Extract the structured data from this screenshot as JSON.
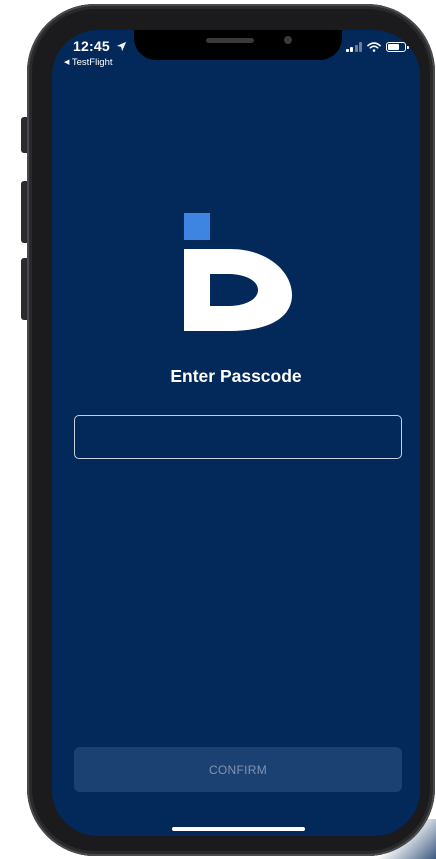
{
  "status_bar": {
    "time": "12:45",
    "back_app": "TestFlight",
    "icons": [
      "location-arrow-icon",
      "cellular-signal-icon",
      "wifi-icon",
      "battery-icon"
    ]
  },
  "logo": {
    "name": "id-logo",
    "colors": {
      "accent": "#3d85e0",
      "glyph": "#ffffff"
    }
  },
  "main": {
    "title": "Enter Passcode",
    "passcode_input": {
      "value": "",
      "placeholder": ""
    },
    "confirm_label": "CONFIRM"
  },
  "colors": {
    "background": "#03295a",
    "button_background": "#1b4173",
    "button_text": "#7f93b0",
    "input_border": "#c7d0dd"
  }
}
